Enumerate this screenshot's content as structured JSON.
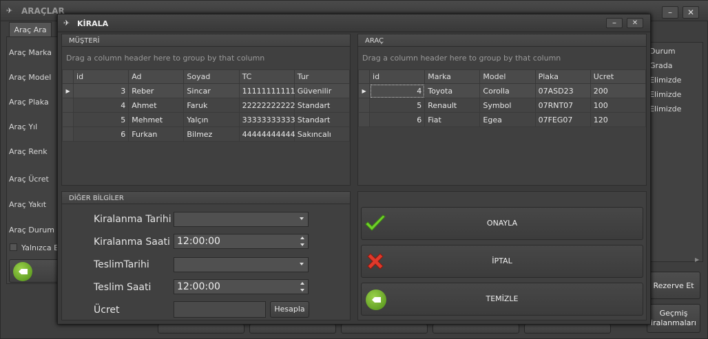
{
  "bg": {
    "title": "ARAÇLAR",
    "tab": "Araç Ara",
    "fields": [
      "Araç Marka",
      "Araç Model",
      "Araç Plaka",
      "Araç Yıl",
      "Araç Renk",
      "Araç Ücret",
      "Araç Yakıt",
      "Araç Durum"
    ],
    "only_checkbox": "Yalnızca Bo",
    "right_col_header": "Durum",
    "right_col_values": [
      "Grada",
      "Elimizde",
      "Elimizde",
      "Elimizde"
    ],
    "reserve_btn": "Rezerve Et",
    "history_btn_line1": "Geçmiş",
    "history_btn_line2": "iralanmaları"
  },
  "dialog": {
    "title": "KİRALA",
    "musteri": {
      "header": "MÜŞTERİ",
      "group_hint": "Drag a column header here to group by that column",
      "columns": [
        "id",
        "Ad",
        "Soyad",
        "TC",
        "Tur"
      ],
      "rows": [
        [
          "3",
          "Reber",
          "Sincar",
          "11111111111",
          "Güvenilir"
        ],
        [
          "4",
          "Ahmet",
          "Faruk",
          "22222222222",
          "Standart"
        ],
        [
          "5",
          "Mehmet",
          "Yalçın",
          "33333333333",
          "Standart"
        ],
        [
          "6",
          "Furkan",
          "Bilmez",
          "44444444444",
          "Sakıncalı"
        ]
      ]
    },
    "arac": {
      "header": "ARAÇ",
      "group_hint": "Drag a column header here to group by that column",
      "columns": [
        "id",
        "Marka",
        "Model",
        "Plaka",
        "Ucret"
      ],
      "rows": [
        [
          "4",
          "Toyota",
          "Corolla",
          "07ASD23",
          "200"
        ],
        [
          "5",
          "Renault",
          "Symbol",
          "07RNT07",
          "100"
        ],
        [
          "6",
          "Fiat",
          "Egea",
          "07FEG07",
          "120"
        ]
      ]
    },
    "diger": {
      "header": "DİĞER BİLGİLER",
      "kiralanma_tarihi": "Kiralanma Tarihi",
      "kiralanma_saati": "Kiralanma Saati",
      "kiralanma_saati_value": "12:00:00",
      "teslim_tarihi": "TeslimTarihi",
      "teslim_saati": "Teslim Saati",
      "teslim_saati_value": "12:00:00",
      "ucret": "Ücret",
      "hesapla": "Hesapla"
    },
    "actions": {
      "onayla": "ONAYLA",
      "iptal": "İPTAL",
      "temizle": "TEMİZLE"
    }
  }
}
